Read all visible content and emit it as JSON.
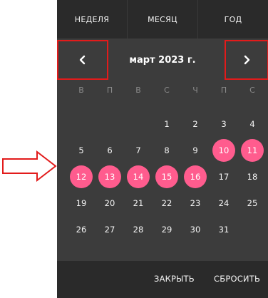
{
  "tabs": [
    "НЕДЕЛЯ",
    "МЕСЯЦ",
    "ГОД"
  ],
  "month_title": "март 2023 г.",
  "weekdays": [
    "В",
    "П",
    "В",
    "С",
    "Ч",
    "П",
    "С"
  ],
  "days": [
    "",
    "",
    "",
    "1",
    "2",
    "3",
    "4",
    "5",
    "6",
    "7",
    "8",
    "9",
    "10",
    "11",
    "12",
    "13",
    "14",
    "15",
    "16",
    "17",
    "18",
    "19",
    "20",
    "21",
    "22",
    "23",
    "24",
    "25",
    "26",
    "27",
    "28",
    "29",
    "30",
    "31",
    ""
  ],
  "selected_days": [
    "10",
    "11",
    "12",
    "13",
    "14",
    "15",
    "16"
  ],
  "footer": {
    "close_label": "ЗАКРЫТЬ",
    "reset_label": "СБРОСИТЬ"
  },
  "colors": {
    "panel_bg": "#3c3c3c",
    "bar_bg": "#2a2a2a",
    "selected": "#ff5c8e",
    "highlight_box": "#e21b1b",
    "annotation_arrow": "#e21b1b"
  },
  "icons": {
    "prev": "chevron-left-icon",
    "next": "chevron-right-icon",
    "annotation": "arrow-right-outline-icon"
  }
}
